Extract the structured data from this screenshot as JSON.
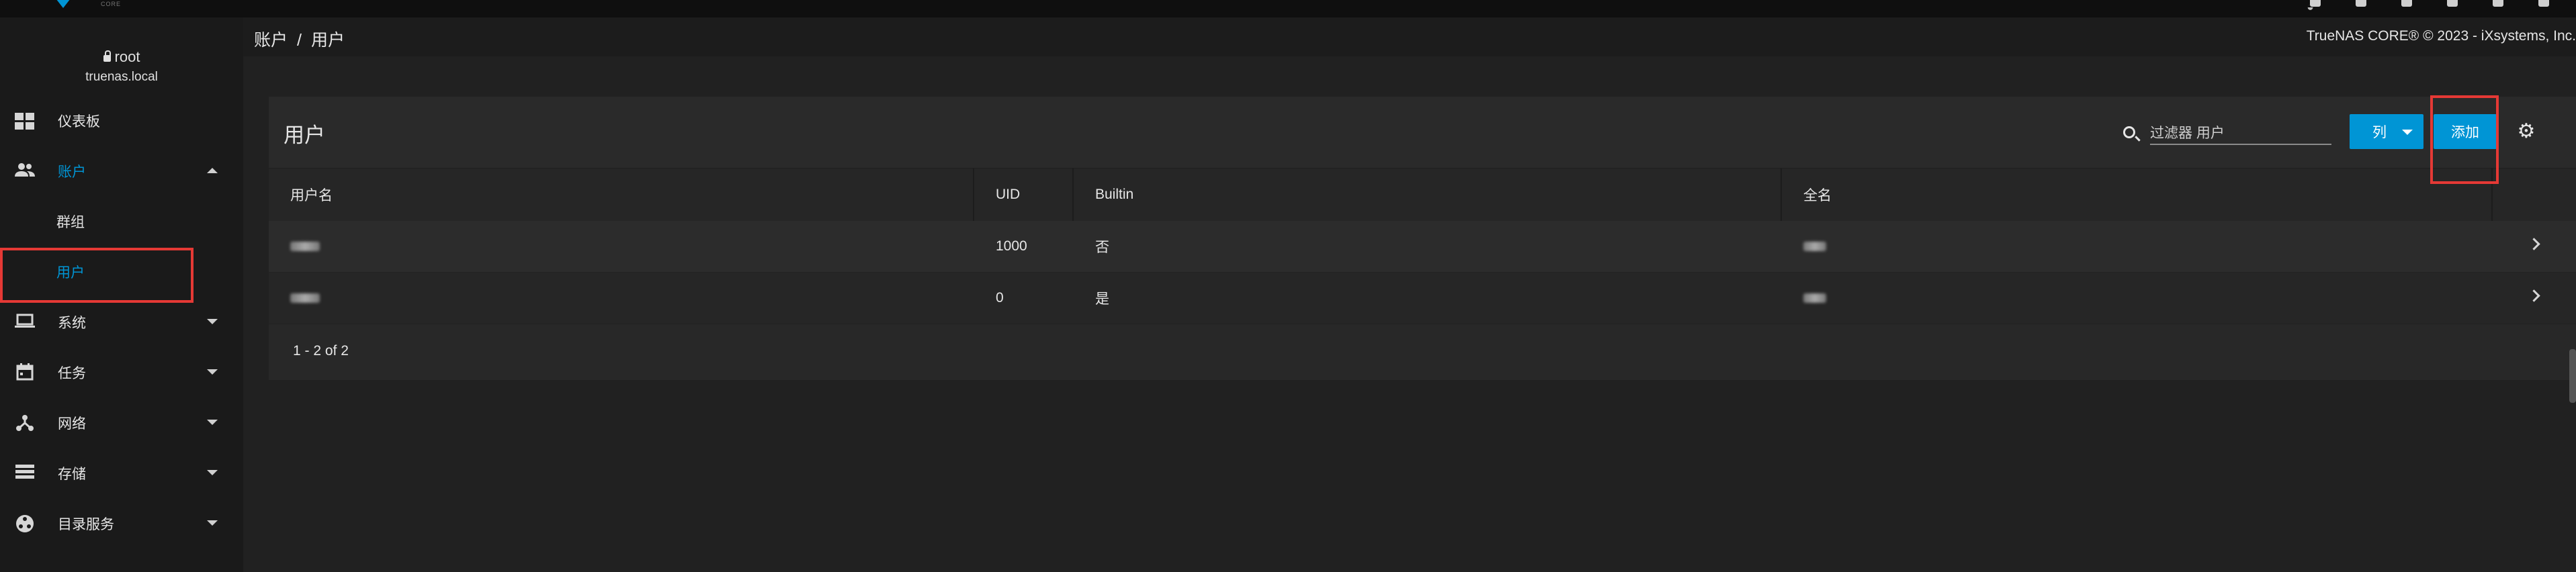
{
  "app": {
    "brand": "TrueNAS",
    "edition": "CORE",
    "vendor_logo": "iXsystems",
    "copyright": "TrueNAS CORE® © 2023 - iXsystems, Inc."
  },
  "colors": {
    "accent": "#0095d5",
    "highlight_box": "#e53935",
    "background": "#212121"
  },
  "profile": {
    "user": "root",
    "host": "truenas.local"
  },
  "sidebar": {
    "items": [
      {
        "label": "仪表板",
        "icon": "dashboard-icon"
      },
      {
        "label": "账户",
        "icon": "people-icon",
        "expanded": true
      },
      {
        "label": "系统",
        "icon": "laptop-icon"
      },
      {
        "label": "任务",
        "icon": "calendar-icon"
      },
      {
        "label": "网络",
        "icon": "network-icon"
      },
      {
        "label": "存储",
        "icon": "storage-icon"
      },
      {
        "label": "目录服务",
        "icon": "directory-services-icon"
      }
    ],
    "account_sub": [
      {
        "label": "群组"
      },
      {
        "label": "用户",
        "active": true
      }
    ]
  },
  "breadcrumb": {
    "parent": "账户",
    "separator": "/",
    "current": "用户"
  },
  "card": {
    "title": "用户",
    "search_placeholder": "过滤器 用户",
    "columns_button": "列",
    "add_button": "添加",
    "settings_icon": "gear-icon"
  },
  "table": {
    "headers": [
      "用户名",
      "UID",
      "Builtin",
      "全名"
    ],
    "rows": [
      {
        "uid": "1000",
        "builtin": "否"
      },
      {
        "uid": "0",
        "builtin": "是"
      }
    ],
    "pagination": "1 - 2 of 2"
  }
}
